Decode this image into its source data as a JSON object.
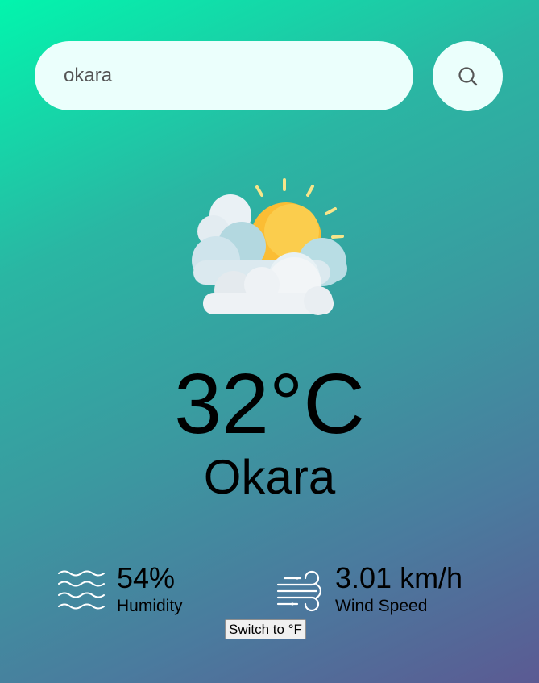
{
  "search": {
    "value": "okara",
    "button_icon": "search-icon"
  },
  "weather": {
    "icon": "partly-cloudy-icon",
    "temperature": "32°C",
    "city": "Okara"
  },
  "humidity": {
    "icon": "humidity-waves-icon",
    "value": "54%",
    "label": "Humidity"
  },
  "wind": {
    "icon": "wind-icon",
    "value": "3.01 km/h",
    "label": "Wind Speed"
  },
  "unit_toggle": {
    "label": "Switch to °F"
  },
  "colors": {
    "gradient_start": "#02f5ad",
    "gradient_end": "#5b5a93",
    "input_background": "#ebfffc"
  }
}
